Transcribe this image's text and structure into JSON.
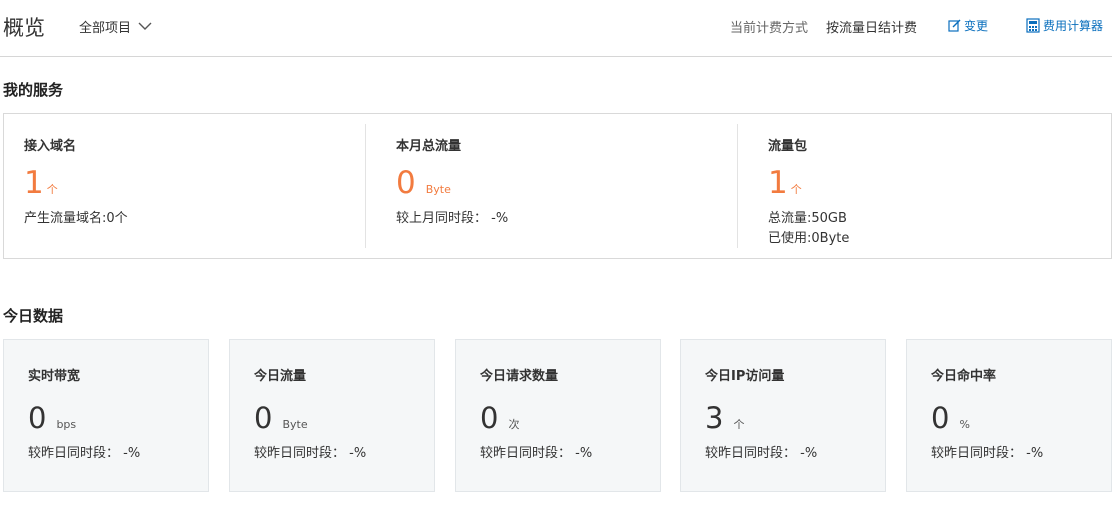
{
  "header": {
    "title": "概览",
    "project_select": "全部项目",
    "billing_label": "当前计费方式",
    "billing_value": "按流量日结计费",
    "change_link": "变更",
    "calculator_link": "费用计算器"
  },
  "services": {
    "title": "我的服务",
    "items": [
      {
        "title": "接入域名",
        "value": "1",
        "unit": "个",
        "lines": [
          "产生流量域名:0个"
        ]
      },
      {
        "title": "本月总流量",
        "value": "0",
        "unit": "Byte",
        "lines": [
          "较上月同时段： -%"
        ]
      },
      {
        "title": "流量包",
        "value": "1",
        "unit": "个",
        "lines": [
          "总流量:50GB",
          "已使用:0Byte"
        ]
      }
    ]
  },
  "today": {
    "title": "今日数据",
    "cards": [
      {
        "title": "实时带宽",
        "value": "0",
        "unit": "bps",
        "compare": "较昨日同时段： -%"
      },
      {
        "title": "今日流量",
        "value": "0",
        "unit": "Byte",
        "compare": "较昨日同时段： -%"
      },
      {
        "title": "今日请求数量",
        "value": "0",
        "unit": "次",
        "compare": "较昨日同时段： -%"
      },
      {
        "title": "今日IP访问量",
        "value": "3",
        "unit": "个",
        "compare": "较昨日同时段： -%"
      },
      {
        "title": "今日命中率",
        "value": "0",
        "unit": "%",
        "compare": "较昨日同时段： -%"
      }
    ]
  },
  "colors": {
    "accent_orange": "#f27b3f",
    "link_blue": "#0a6fbd",
    "card_bg": "#f5f7f8"
  },
  "icons": {
    "project_dropdown": "chevron-down-icon",
    "change": "edit-icon",
    "calculator": "calculator-icon"
  }
}
